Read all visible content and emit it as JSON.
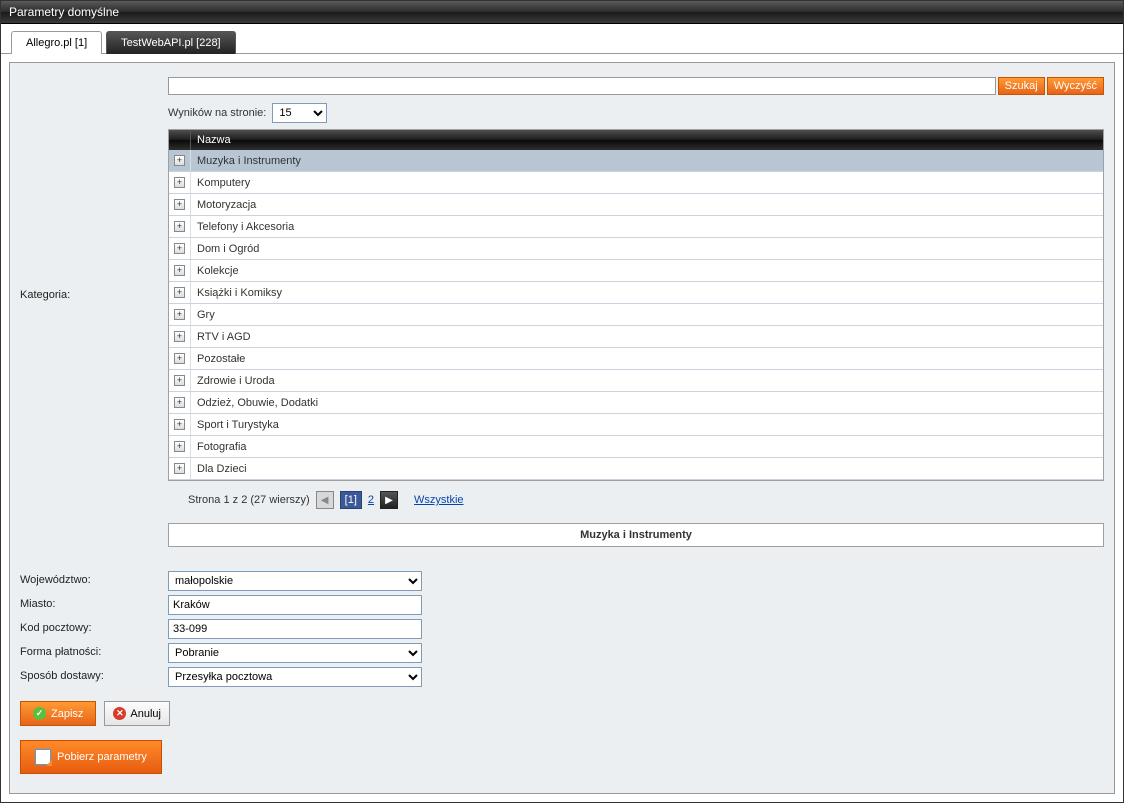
{
  "window": {
    "title": "Parametry domyślne"
  },
  "tabs": [
    {
      "label": "Allegro.pl [1]",
      "active": true
    },
    {
      "label": "TestWebAPI.pl [228]",
      "active": false
    }
  ],
  "search": {
    "value": "",
    "btn_search": "Szukaj",
    "btn_clear": "Wyczyść"
  },
  "results_per_page": {
    "label": "Wyników na stronie:",
    "value": "15"
  },
  "category": {
    "label": "Kategoria:",
    "header_name": "Nazwa",
    "rows": [
      "Muzyka i Instrumenty",
      "Komputery",
      "Motoryzacja",
      "Telefony i Akcesoria",
      "Dom i Ogród",
      "Kolekcje",
      "Książki i Komiksy",
      "Gry",
      "RTV i AGD",
      "Pozostałe",
      "Zdrowie i Uroda",
      "Odzież, Obuwie, Dodatki",
      "Sport i Turystyka",
      "Fotografia",
      "Dla Dzieci"
    ],
    "selected_index": 0,
    "selected_label": "Muzyka i Instrumenty"
  },
  "pager": {
    "summary": "Strona 1 z 2 (27 wierszy)",
    "current": "[1]",
    "page2": "2",
    "all": "Wszystkie"
  },
  "form": {
    "wojewodztwo": {
      "label": "Województwo:",
      "value": "małopolskie"
    },
    "miasto": {
      "label": "Miasto:",
      "value": "Kraków"
    },
    "kod": {
      "label": "Kod pocztowy:",
      "value": "33-099"
    },
    "platnosc": {
      "label": "Forma płatności:",
      "value": "Pobranie"
    },
    "dostawa": {
      "label": "Sposób dostawy:",
      "value": "Przesyłka pocztowa"
    }
  },
  "buttons": {
    "save": "Zapisz",
    "cancel": "Anuluj",
    "download": "Pobierz parametry"
  }
}
